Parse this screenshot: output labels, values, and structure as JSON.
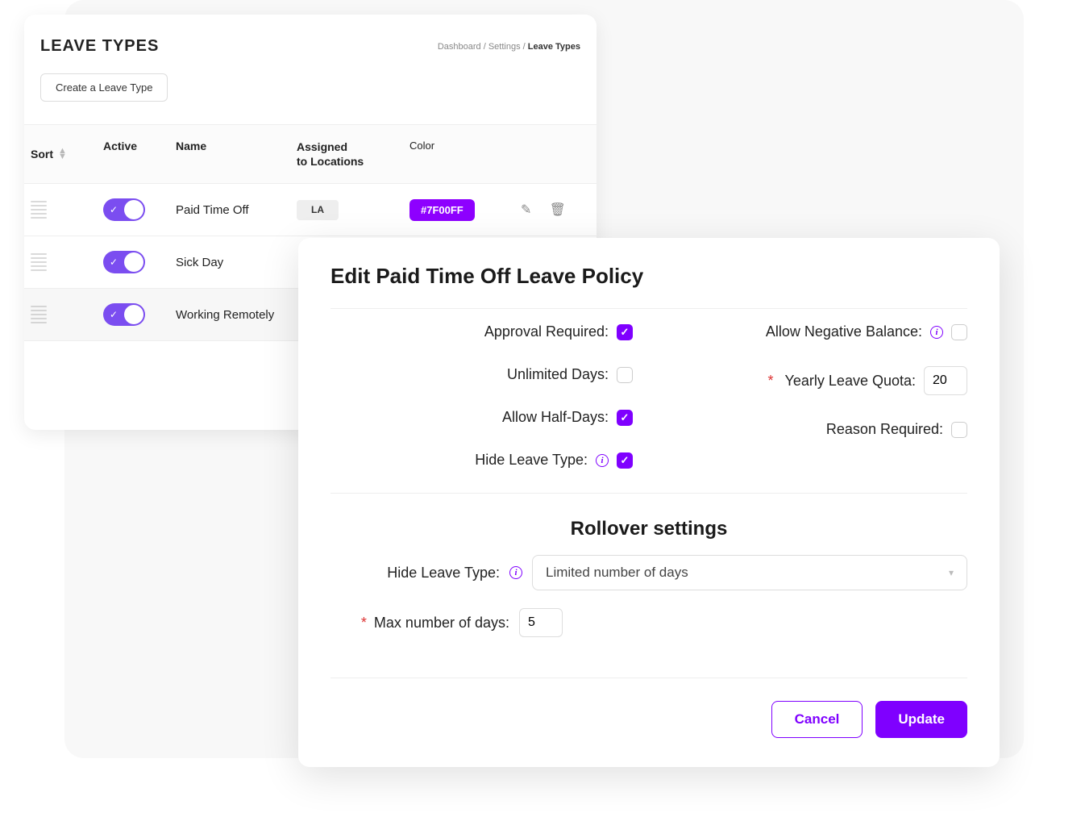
{
  "page": {
    "title": "LEAVE TYPES",
    "breadcrumb": {
      "dashboard": "Dashboard",
      "settings": "Settings",
      "current": "Leave Types",
      "sep": " / "
    },
    "create_btn": "Create a Leave Type"
  },
  "table": {
    "headers": {
      "sort": "Sort",
      "active": "Active",
      "name": "Name",
      "locations_l1": "Assigned",
      "locations_l2": "to Locations",
      "color": "Color"
    },
    "rows": [
      {
        "name": "Paid Time Off",
        "active": true,
        "location": "LA",
        "color": "#7F00FF",
        "show_actions": true
      },
      {
        "name": "Sick Day",
        "active": true
      },
      {
        "name": "Working Remotely",
        "active": true
      }
    ]
  },
  "modal": {
    "title": "Edit Paid Time Off Leave Policy",
    "fields": {
      "approval_required": {
        "label": "Approval Required:",
        "checked": true
      },
      "unlimited_days": {
        "label": "Unlimited Days:",
        "checked": false
      },
      "allow_half_days": {
        "label": "Allow Half-Days:",
        "checked": true
      },
      "hide_leave_type": {
        "label": "Hide Leave Type:",
        "checked": true,
        "info": true
      },
      "allow_negative": {
        "label": "Allow Negative Balance:",
        "checked": false,
        "info": true
      },
      "yearly_quota": {
        "label": "Yearly Leave Quota:",
        "value": "20",
        "required": true
      },
      "reason_required": {
        "label": "Reason Required:",
        "checked": false
      }
    },
    "rollover": {
      "title": "Rollover settings",
      "hide_label": "Hide Leave Type:",
      "select_value": "Limited number of days",
      "max_label": "Max number of days:",
      "max_value": "5"
    },
    "buttons": {
      "cancel": "Cancel",
      "update": "Update"
    }
  }
}
